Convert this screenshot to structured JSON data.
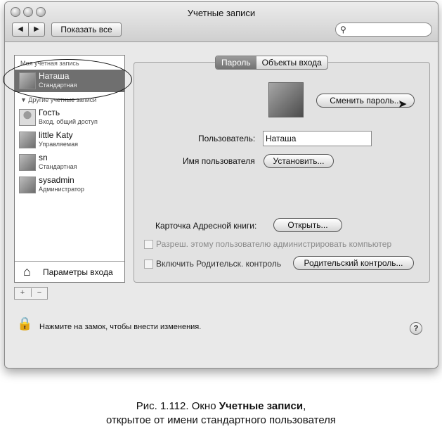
{
  "window": {
    "title": "Учетные записи"
  },
  "toolbar": {
    "back": "◀",
    "forward": "▶",
    "show_all": "Показать все",
    "search_placeholder": ""
  },
  "sidebar": {
    "my_account_header": "Моя учетная запись",
    "other_accounts_header": "▼ Другие учетные записи",
    "users": [
      {
        "name": "Наташа",
        "role": "Стандартная"
      },
      {
        "name": "Гость",
        "role": "Вход, общий доступ"
      },
      {
        "name": "little Katy",
        "role": "Управляемая"
      },
      {
        "name": "sn",
        "role": "Стандартная"
      },
      {
        "name": "sysadmin",
        "role": "Администратор"
      }
    ],
    "login_options": "Параметры входа",
    "plus": "+",
    "minus": "−"
  },
  "tabs": {
    "password": "Пароль",
    "login_items": "Объекты входа"
  },
  "panel": {
    "change_password": "Сменить пароль...",
    "user_label": "Пользователь:",
    "user_value": "Наташа",
    "username_label": "Имя пользователя",
    "set_button": "Установить...",
    "address_card_label": "Карточка Адресной книги:",
    "open_button": "Открыть...",
    "admin_checkbox": "Разреш. этому пользователю администрировать компьютер",
    "parental_checkbox": "Включить Родительск. контроль",
    "parental_button": "Родительский контроль..."
  },
  "footer": {
    "lock_text": "Нажмите на замок, чтобы внести изменения.",
    "help": "?"
  },
  "caption": {
    "prefix": "Рис. 1.112.",
    "mid": " Окно ",
    "bold": "Учетные записи",
    "end": ",",
    "line2": "открытое от имени стандартного пользователя"
  }
}
